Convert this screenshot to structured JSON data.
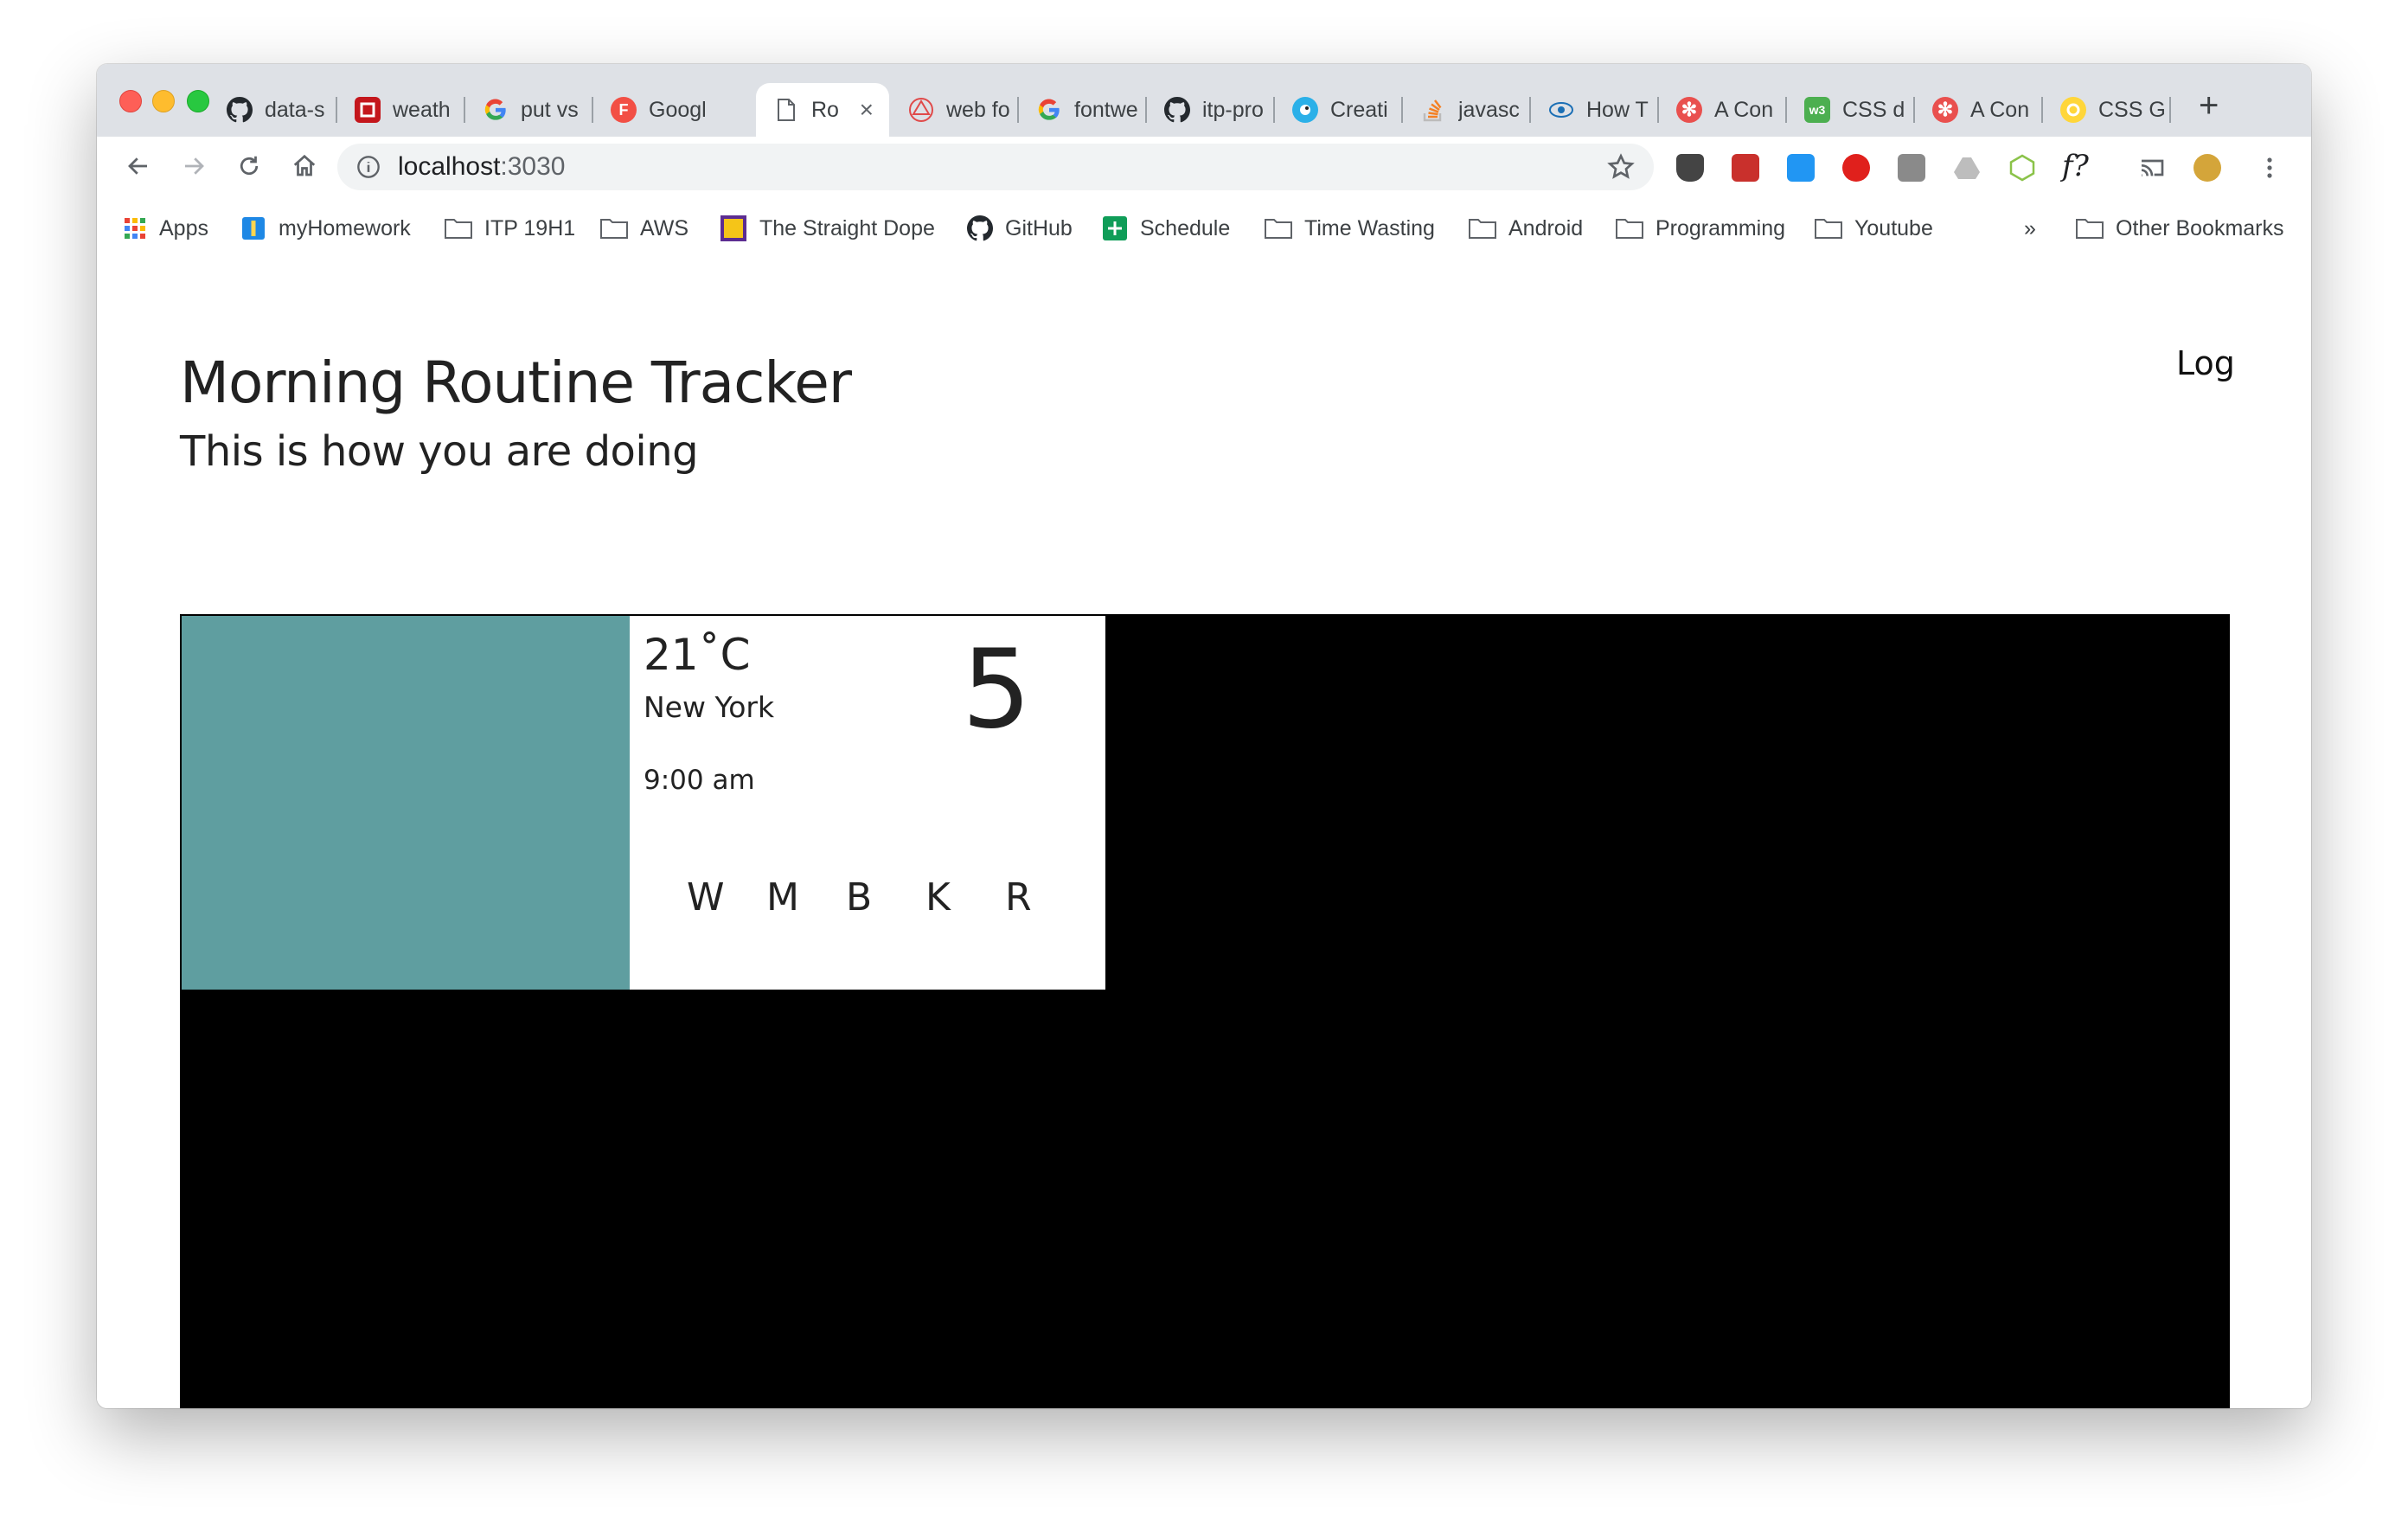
{
  "tabs": [
    {
      "title": "data-s",
      "icon": "github-icon"
    },
    {
      "title": "weath",
      "icon": "red-square-icon"
    },
    {
      "title": "put vs",
      "icon": "google-icon"
    },
    {
      "title": "Googl",
      "icon": "red-circle-f-icon"
    },
    {
      "title": "Ro",
      "icon": "page-icon",
      "active": true
    },
    {
      "title": "web fo",
      "icon": "red-hexagon-icon"
    },
    {
      "title": "fontwe",
      "icon": "google-icon"
    },
    {
      "title": "itp-pro",
      "icon": "github-icon"
    },
    {
      "title": "Creati",
      "icon": "bird-icon"
    },
    {
      "title": "javasc",
      "icon": "stackoverflow-icon"
    },
    {
      "title": "How T",
      "icon": "eye-icon"
    },
    {
      "title": "A Con",
      "icon": "asterisk-icon"
    },
    {
      "title": "CSS d",
      "icon": "green-w3-icon"
    },
    {
      "title": "A Con",
      "icon": "asterisk-icon"
    },
    {
      "title": "CSS G",
      "icon": "yellow-circle-icon"
    }
  ],
  "address": {
    "host": "localhost",
    "port": ":3030"
  },
  "bookmarks": [
    {
      "label": "Apps"
    },
    {
      "label": "myHomework"
    },
    {
      "label": "ITP 19H1"
    },
    {
      "label": "AWS"
    },
    {
      "label": "The Straight Dope"
    },
    {
      "label": "GitHub"
    },
    {
      "label": "Schedule"
    },
    {
      "label": "Time Wasting"
    },
    {
      "label": "Android"
    },
    {
      "label": "Programming"
    },
    {
      "label": "Youtube"
    },
    {
      "label": "Other Bookmarks"
    }
  ],
  "bookmarks_overflow": "»",
  "page": {
    "title": "Morning Routine Tracker",
    "subtitle": "This is how you are doing",
    "nav_log": "Log"
  },
  "card": {
    "temperature": "21˚C",
    "city": "New York",
    "time": "9:00 am",
    "score": "5",
    "letters": [
      "W",
      "M",
      "B",
      "K",
      "R"
    ]
  },
  "colors": {
    "teal_panel": "#5f9ea0",
    "dashboard_bg": "#000000"
  }
}
